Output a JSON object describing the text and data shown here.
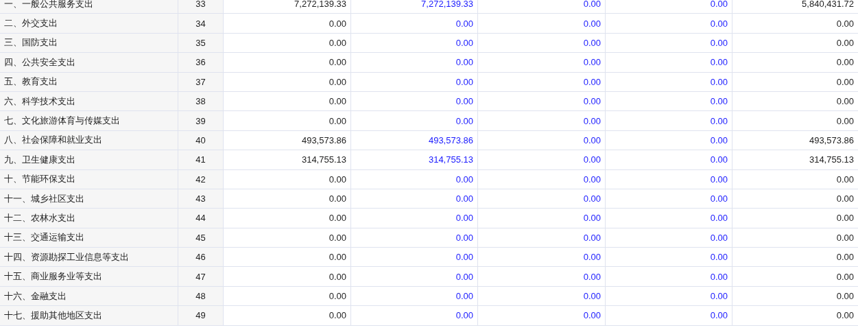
{
  "columns": [
    {
      "kind": "plain"
    },
    {
      "kind": "linked"
    },
    {
      "kind": "linked"
    },
    {
      "kind": "linked"
    },
    {
      "kind": "plain"
    }
  ],
  "rows": [
    {
      "label": "一、一般公共服务支出",
      "line": "33",
      "values": [
        "7,272,139.33",
        "7,272,139.33",
        "0.00",
        "0.00",
        "5,840,431.72"
      ]
    },
    {
      "label": "二、外交支出",
      "line": "34",
      "values": [
        "0.00",
        "0.00",
        "0.00",
        "0.00",
        "0.00"
      ]
    },
    {
      "label": "三、国防支出",
      "line": "35",
      "values": [
        "0.00",
        "0.00",
        "0.00",
        "0.00",
        "0.00"
      ]
    },
    {
      "label": "四、公共安全支出",
      "line": "36",
      "values": [
        "0.00",
        "0.00",
        "0.00",
        "0.00",
        "0.00"
      ]
    },
    {
      "label": "五、教育支出",
      "line": "37",
      "values": [
        "0.00",
        "0.00",
        "0.00",
        "0.00",
        "0.00"
      ]
    },
    {
      "label": "六、科学技术支出",
      "line": "38",
      "values": [
        "0.00",
        "0.00",
        "0.00",
        "0.00",
        "0.00"
      ]
    },
    {
      "label": "七、文化旅游体育与传媒支出",
      "line": "39",
      "values": [
        "0.00",
        "0.00",
        "0.00",
        "0.00",
        "0.00"
      ]
    },
    {
      "label": "八、社会保障和就业支出",
      "line": "40",
      "values": [
        "493,573.86",
        "493,573.86",
        "0.00",
        "0.00",
        "493,573.86"
      ]
    },
    {
      "label": "九、卫生健康支出",
      "line": "41",
      "values": [
        "314,755.13",
        "314,755.13",
        "0.00",
        "0.00",
        "314,755.13"
      ]
    },
    {
      "label": "十、节能环保支出",
      "line": "42",
      "values": [
        "0.00",
        "0.00",
        "0.00",
        "0.00",
        "0.00"
      ]
    },
    {
      "label": "十一、城乡社区支出",
      "line": "43",
      "values": [
        "0.00",
        "0.00",
        "0.00",
        "0.00",
        "0.00"
      ]
    },
    {
      "label": "十二、农林水支出",
      "line": "44",
      "values": [
        "0.00",
        "0.00",
        "0.00",
        "0.00",
        "0.00"
      ]
    },
    {
      "label": "十三、交通运输支出",
      "line": "45",
      "values": [
        "0.00",
        "0.00",
        "0.00",
        "0.00",
        "0.00"
      ]
    },
    {
      "label": "十四、资源勘探工业信息等支出",
      "line": "46",
      "values": [
        "0.00",
        "0.00",
        "0.00",
        "0.00",
        "0.00"
      ]
    },
    {
      "label": "十五、商业服务业等支出",
      "line": "47",
      "values": [
        "0.00",
        "0.00",
        "0.00",
        "0.00",
        "0.00"
      ]
    },
    {
      "label": "十六、金融支出",
      "line": "48",
      "values": [
        "0.00",
        "0.00",
        "0.00",
        "0.00",
        "0.00"
      ]
    },
    {
      "label": "十七、援助其他地区支出",
      "line": "49",
      "values": [
        "0.00",
        "0.00",
        "0.00",
        "0.00",
        "0.00"
      ]
    }
  ]
}
